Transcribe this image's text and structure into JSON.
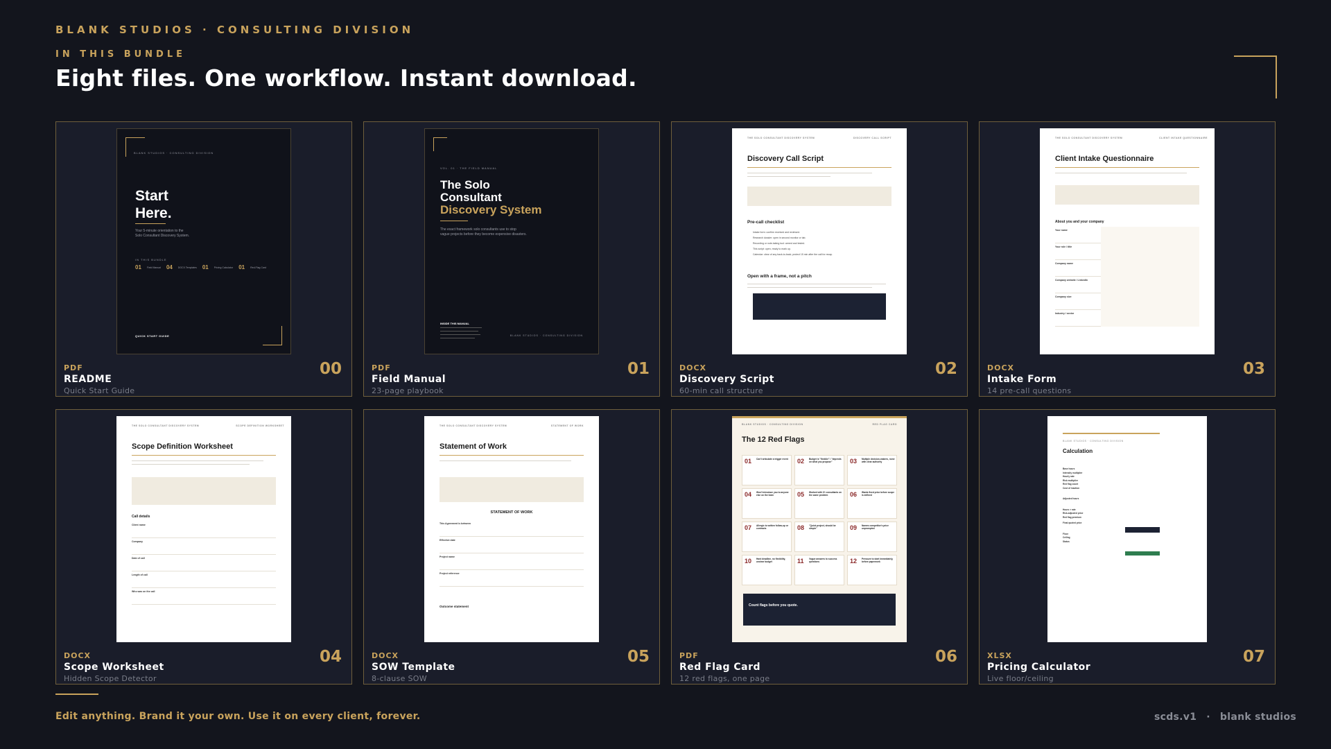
{
  "header": {
    "eyebrow": "BLANK STUDIOS · CONSULTING DIVISION",
    "section_label": "IN THIS BUNDLE",
    "headline": "Eight files. One workflow. Instant download."
  },
  "cards": [
    {
      "type": "PDF",
      "name": "README",
      "desc": "Quick Start Guide",
      "num": "00"
    },
    {
      "type": "PDF",
      "name": "Field Manual",
      "desc": "23-page playbook",
      "num": "01"
    },
    {
      "type": "DOCX",
      "name": "Discovery Script",
      "desc": "60-min call structure",
      "num": "02"
    },
    {
      "type": "DOCX",
      "name": "Intake Form",
      "desc": "14 pre-call questions",
      "num": "03"
    },
    {
      "type": "DOCX",
      "name": "Scope Worksheet",
      "desc": "Hidden Scope Detector",
      "num": "04"
    },
    {
      "type": "DOCX",
      "name": "SOW Template",
      "desc": "8-clause SOW",
      "num": "05"
    },
    {
      "type": "PDF",
      "name": "Red Flag Card",
      "desc": "12 red flags, one page",
      "num": "06"
    },
    {
      "type": "XLSX",
      "name": "Pricing Calculator",
      "desc": "Live floor/ceiling",
      "num": "07"
    }
  ],
  "thumbs": {
    "readme": {
      "brand": "BLANK STUDIOS · CONSULTING DIVISION",
      "title_1": "Start",
      "title_2": "Here.",
      "sub_1": "Your 5-minute orientation to the",
      "sub_2": "Solo Consultant Discovery System.",
      "bundle_label": "IN THIS BUNDLE",
      "items": [
        {
          "n": "01",
          "t": "Field Manual"
        },
        {
          "n": "04",
          "t": "DOCX Templates"
        },
        {
          "n": "01",
          "t": "Pricing Calculator"
        },
        {
          "n": "01",
          "t": "Red-Flag Card"
        }
      ],
      "guide": "QUICK START GUIDE"
    },
    "manual": {
      "vol": "VOL. 01 · THE FIELD MANUAL",
      "title_1": "The Solo",
      "title_2": "Consultant",
      "title_3": "Discovery System",
      "sub_1": "The exact framework solo consultants use to stop",
      "sub_2": "vague projects before they become expensive disasters.",
      "inside": "INSIDE THIS MANUAL",
      "brand": "BLANK STUDIOS · CONSULTING DIVISION"
    },
    "script": {
      "top_left": "THE SOLO CONSULTANT DISCOVERY SYSTEM",
      "top_right": "DISCOVERY CALL SCRIPT",
      "title": "Discovery Call Script",
      "h1": "Pre-call checklist",
      "h2": "Open with a frame, not a pitch",
      "checklist": [
        "Intake form: confirm received and reviewed.",
        "Research dossier: open in second monitor or tab.",
        "Recording or note-taking tool: armed and tested.",
        "This script: open, ready to mark up.",
        "Calendar: clear of any back-to-back; protect 15 min after the call for recap."
      ]
    },
    "intake": {
      "top_left": "THE SOLO CONSULTANT DISCOVERY SYSTEM",
      "top_right": "CLIENT INTAKE QUESTIONNAIRE",
      "title": "Client Intake Questionnaire",
      "h1": "About you and your company",
      "fields": [
        "Your name",
        "Your role / title",
        "Company name",
        "Company website / LinkedIn",
        "Company size",
        "Industry / sector"
      ]
    },
    "scope": {
      "top_left": "THE SOLO CONSULTANT DISCOVERY SYSTEM",
      "top_right": "SCOPE DEFINITION WORKSHEET",
      "title": "Scope Definition Worksheet",
      "h1": "Call details",
      "fields": [
        "Client name",
        "Company",
        "Date of call",
        "Length of call",
        "Who was on the call"
      ]
    },
    "sow": {
      "top_left": "THE SOLO CONSULTANT DISCOVERY SYSTEM",
      "top_right": "STATEMENT OF WORK",
      "title": "Statement of Work",
      "h1": "STATEMENT OF WORK",
      "fields": [
        "This Agreement is between",
        "Effective date",
        "Project name",
        "Project reference"
      ],
      "h2": "Outcome statement"
    },
    "redflag": {
      "top_left": "BLANK STUDIOS · CONSULTING DIVISION",
      "top_right": "RED FLAG CARD",
      "title": "The 12 Red Flags",
      "count_title": "Count flags before you quote.",
      "flags": [
        {
          "n": "01",
          "t": "Can't articulate a trigger event"
        },
        {
          "n": "02",
          "t": "Budget is \"flexible\" / \"depends on what you propose\""
        },
        {
          "n": "03",
          "t": "Multiple decision-makers, none with clear authority"
        },
        {
          "n": "04",
          "t": "Won't introduce you to anyone else on the team"
        },
        {
          "n": "05",
          "t": "Worked with 3+ consultants on the same problem"
        },
        {
          "n": "06",
          "t": "Wants fixed price before scope is defined"
        },
        {
          "n": "07",
          "t": "Allergic to written follow-up or contracts"
        },
        {
          "n": "08",
          "t": "\"Quick project, should be simple\""
        },
        {
          "n": "09",
          "t": "Names competitor's price unprompted"
        },
        {
          "n": "10",
          "t": "Hard deadline, no flexibility, unclear budget"
        },
        {
          "n": "11",
          "t": "Vague answers to success questions"
        },
        {
          "n": "12",
          "t": "Pressure to start immediately, before paperwork"
        }
      ]
    },
    "pricing": {
      "brand": "BLANK STUDIOS · CONSULTING DIVISION",
      "title": "Calculation",
      "rows": [
        "Base hours",
        "Intensity multiplier",
        "Hourly rate",
        "Risk multiplier",
        "Red flag count",
        "Cost of inaction",
        "Adjusted hours",
        "Hours × rate",
        "Risk-adjusted price",
        "Red flag premium",
        "Final quoted price",
        "Floor",
        "Ceiling",
        "Status"
      ]
    }
  },
  "footer": {
    "tagline": "Edit anything. Brand it your own. Use it on every client, forever.",
    "version": "scds.v1",
    "separator": "·",
    "studio": "blank studios"
  },
  "colors": {
    "background": "#13151d",
    "card": "#1a1d2a",
    "accent_gold": "#c9a35c",
    "muted": "#7a7d88"
  }
}
